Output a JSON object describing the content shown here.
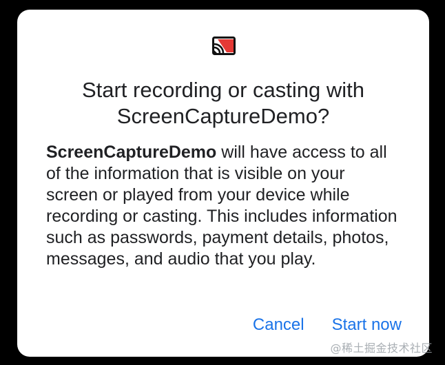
{
  "dialog": {
    "icon": "cast-icon",
    "title": "Start recording or casting with ScreenCaptureDemo?",
    "body_app_name": "ScreenCaptureDemo",
    "body_text": " will have access to all of the information that is visible on your screen or played from your device while recording or casting. This includes information such as passwords, payment details, photos, messages, and audio that you play.",
    "cancel_label": "Cancel",
    "start_label": "Start now"
  },
  "colors": {
    "accent": "#1a73e8",
    "icon_red": "#e53935",
    "text": "#202124"
  },
  "watermark": "@稀土掘金技术社区"
}
